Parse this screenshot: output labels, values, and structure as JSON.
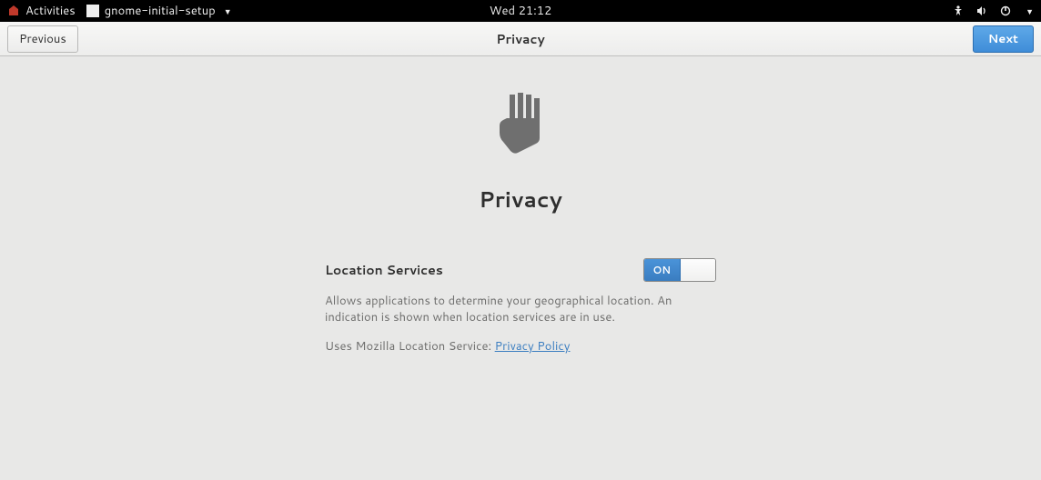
{
  "topbar": {
    "activities_label": "Activities",
    "app_name": "gnome-initial-setup",
    "clock": "Wed 21:12"
  },
  "header": {
    "previous_label": "Previous",
    "title": "Privacy",
    "next_label": "Next"
  },
  "page": {
    "title": "Privacy"
  },
  "location": {
    "row_label": "Location Services",
    "switch_text": "ON",
    "switch_state": "on",
    "description": "Allows applications to determine your geographical location. An indication is shown when location services are in use.",
    "provider_text": "Uses Mozilla Location Service: ",
    "privacy_policy_label": "Privacy Policy"
  }
}
